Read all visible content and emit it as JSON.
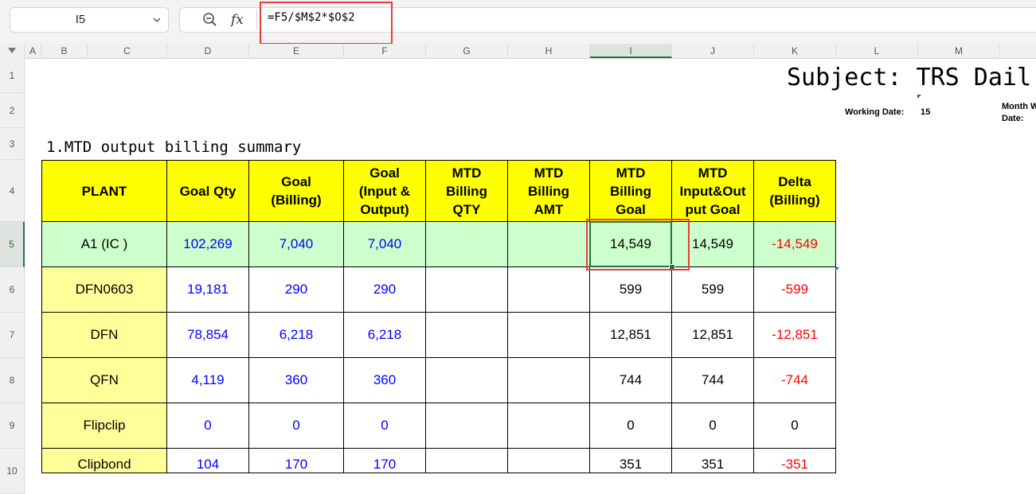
{
  "formula_bar": {
    "name_box": "I5",
    "formula": "=F5/$M$2*$O$2",
    "fx_label": "fx"
  },
  "columns": [
    "A",
    "B",
    "C",
    "D",
    "E",
    "F",
    "G",
    "H",
    "I",
    "J",
    "K",
    "L",
    "M"
  ],
  "rows": [
    "1",
    "2",
    "3",
    "4",
    "5",
    "6",
    "7",
    "8",
    "9",
    "10"
  ],
  "selected_cell": "I5",
  "sheet": {
    "title": "Subject: TRS Dail",
    "working_date_label": "Working Date:",
    "working_date_value": "15",
    "month_label_line1": "Month W",
    "month_label_line2": "Date:",
    "section_title": "1.MTD output billing summary"
  },
  "table": {
    "headers": [
      "PLANT",
      "Goal Qty",
      "Goal\n(Billing)",
      "Goal\n(Input &\nOutput)",
      "MTD\nBilling\nQTY",
      "MTD\nBilling\nAMT",
      "MTD\nBilling\nGoal",
      "MTD\nInput&Out\nput Goal",
      "Delta\n(Billing)"
    ],
    "rows": [
      [
        "A1 (IC )",
        "102,269",
        "7,040",
        "7,040",
        "",
        "",
        "14,549",
        "14,549",
        "-14,549"
      ],
      [
        "DFN0603",
        "19,181",
        "290",
        "290",
        "",
        "",
        "599",
        "599",
        "-599"
      ],
      [
        "DFN",
        "78,854",
        "6,218",
        "6,218",
        "",
        "",
        "12,851",
        "12,851",
        "-12,851"
      ],
      [
        "QFN",
        "4,119",
        "360",
        "360",
        "",
        "",
        "744",
        "744",
        "-744"
      ],
      [
        "Flipclip",
        "0",
        "0",
        "0",
        "",
        "",
        "0",
        "0",
        "0"
      ],
      [
        "Clipbond",
        "104",
        "170",
        "170",
        "",
        "",
        "351",
        "351",
        "-351"
      ]
    ]
  },
  "colors": {
    "header_fill": "#ffff00",
    "plant_fill": "#ffff99",
    "selected_row_fill": "#ccffcc",
    "goal_text": "#0000ff",
    "delta_text": "#ff0000",
    "highlight": "#e63b3b",
    "selection": "#217346"
  }
}
